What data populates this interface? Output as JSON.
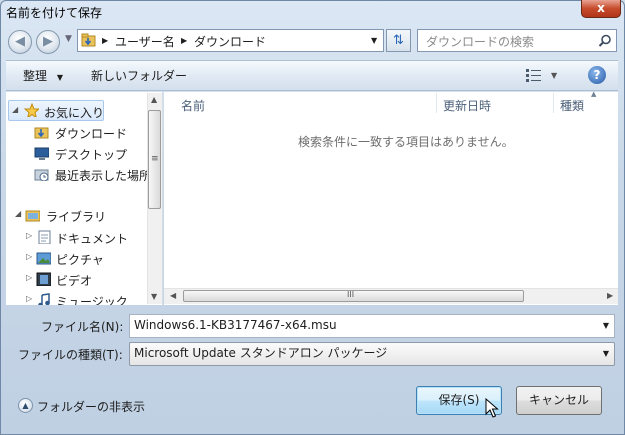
{
  "window": {
    "title": "名前を付けて保存",
    "close_glyph": "x"
  },
  "nav": {
    "address_segments": [
      "ユーザー名",
      "ダウンロード"
    ],
    "search_placeholder": "ダウンロードの検索"
  },
  "toolbar": {
    "organize_label": "整理",
    "new_folder_label": "新しいフォルダー",
    "help_glyph": "?"
  },
  "sidebar": {
    "favorites": {
      "label": "お気に入り",
      "items": [
        {
          "label": "ダウンロード",
          "icon": "download-folder-icon"
        },
        {
          "label": "デスクトップ",
          "icon": "desktop-icon"
        },
        {
          "label": "最近表示した場所",
          "icon": "recent-places-icon"
        }
      ]
    },
    "libraries": {
      "label": "ライブラリ",
      "items": [
        {
          "label": "ドキュメント",
          "icon": "documents-icon"
        },
        {
          "label": "ピクチャ",
          "icon": "pictures-icon"
        },
        {
          "label": "ビデオ",
          "icon": "videos-icon"
        },
        {
          "label": "ミュージック",
          "icon": "music-icon"
        }
      ]
    }
  },
  "file_list": {
    "columns": [
      "名前",
      "更新日時",
      "種類"
    ],
    "empty_message": "検索条件に一致する項目はありません。",
    "scroll_grip": "III"
  },
  "form": {
    "filename_label": "ファイル名(N):",
    "filename_value": "Windows6.1-KB3177467-x64.msu",
    "filetype_label": "ファイルの種類(T):",
    "filetype_value": "Microsoft Update スタンドアロン パッケージ"
  },
  "footer": {
    "hide_folders_label": "フォルダーの非表示",
    "save_label": "保存(S)",
    "cancel_label": "キャンセル"
  },
  "colors": {
    "accent": "#3c7fb1",
    "selection": "#d9e9fb",
    "close": "#c74a2c"
  }
}
